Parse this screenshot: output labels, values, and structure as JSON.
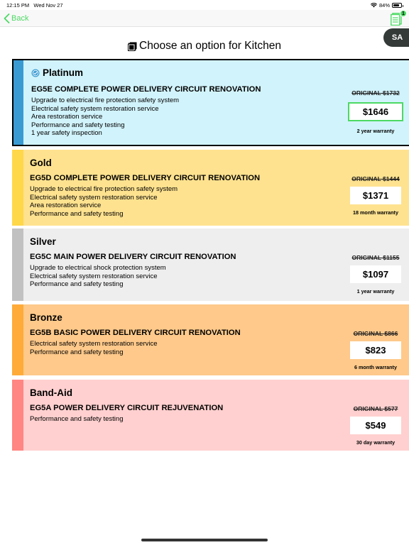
{
  "status": {
    "time": "12:15 PM",
    "date": "Wed Nov 27",
    "battery": "84%",
    "battery_level": 0.84
  },
  "nav": {
    "back_label": "Back",
    "doc_count": "1"
  },
  "user": {
    "initials": "SA"
  },
  "title": "Choose an option for Kitchen",
  "options": [
    {
      "tier": "Platinum",
      "code": "EG5E COMPLETE POWER DELIVERY CIRCUIT RENOVATION",
      "features": [
        "Upgrade to electrical fire protection safety system",
        "Electrical safety system restoration service",
        "Area restoration service",
        "Performance and safety testing",
        "1 year safety inspection"
      ],
      "original": "ORIGINAL $1732",
      "price": "$1646",
      "warranty": "2 year warranty",
      "accent": "#3a9bd3",
      "background": "#d1f3fb"
    },
    {
      "tier": "Gold",
      "code": "EG5D COMPLETE POWER DELIVERY CIRCUIT RENOVATION",
      "features": [
        "Upgrade to electrical fire protection safety system",
        "Electrical safety system restoration service",
        "Area restoration service",
        "Performance and safety testing"
      ],
      "original": "ORIGINAL $1444",
      "price": "$1371",
      "warranty": "18 month warranty",
      "accent": "#ffd84a",
      "background": "#fee28f"
    },
    {
      "tier": "Silver",
      "code": "EG5C MAIN POWER DELIVERY CIRCUIT RENOVATION",
      "features": [
        "Upgrade to electrical shock protection system",
        "Electrical safety system restoration service",
        "Performance and safety testing"
      ],
      "original": "ORIGINAL $1155",
      "price": "$1097",
      "warranty": "1 year warranty",
      "accent": "#c1c1c1",
      "background": "#eeeeee"
    },
    {
      "tier": "Bronze",
      "code": "EG5B BASIC POWER DELIVERY CIRCUIT RENOVATION",
      "features": [
        "Electrical safety system restoration service",
        "Performance and safety testing"
      ],
      "original": "ORIGINAL $866",
      "price": "$823",
      "warranty": "6 month warranty",
      "accent": "#ffab39",
      "background": "#fec98a"
    },
    {
      "tier": "Band-Aid",
      "code": "EG5A POWER DELIVERY CIRCUIT REJUVENATION",
      "features": [
        "Performance and safety testing"
      ],
      "original": "ORIGINAL $577",
      "price": "$549",
      "warranty": "30 day warranty",
      "accent": "#ff8682",
      "background": "#ffd0cf"
    }
  ],
  "colors": {
    "brand_green": "#4cd964",
    "selected_border": "#000000"
  }
}
